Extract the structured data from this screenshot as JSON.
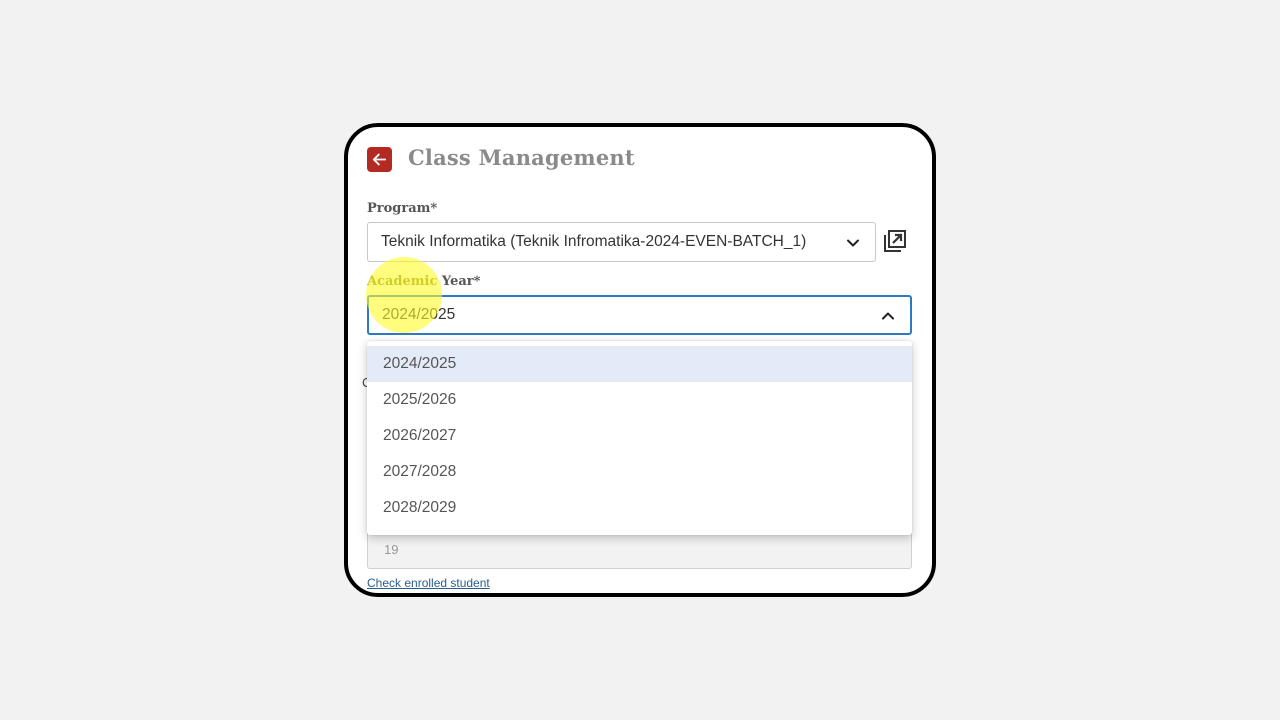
{
  "header": {
    "title": "Class Management",
    "back_icon": "arrow-left-icon"
  },
  "program": {
    "label": "Program*",
    "value": "Teknik Informatika (Teknik Infromatika-2024-EVEN-BATCH_1)",
    "open_icon": "open-external-icon"
  },
  "academic_year": {
    "label_part1": "Academic",
    "label_part2": " Year*",
    "value": "2024/2025",
    "options": [
      "2024/2025",
      "2025/2026",
      "2026/2027",
      "2027/2028",
      "2028/2029"
    ],
    "selected_index": 0
  },
  "covered": {
    "partial_char": "C"
  },
  "student_count": {
    "value": "19"
  },
  "links": {
    "check_enrolled": "Check enrolled student"
  },
  "colors": {
    "accent": "#b22a22",
    "focus": "#2f78c4",
    "selected_bg": "#e2ebf7",
    "highlight": "#fffa28"
  }
}
